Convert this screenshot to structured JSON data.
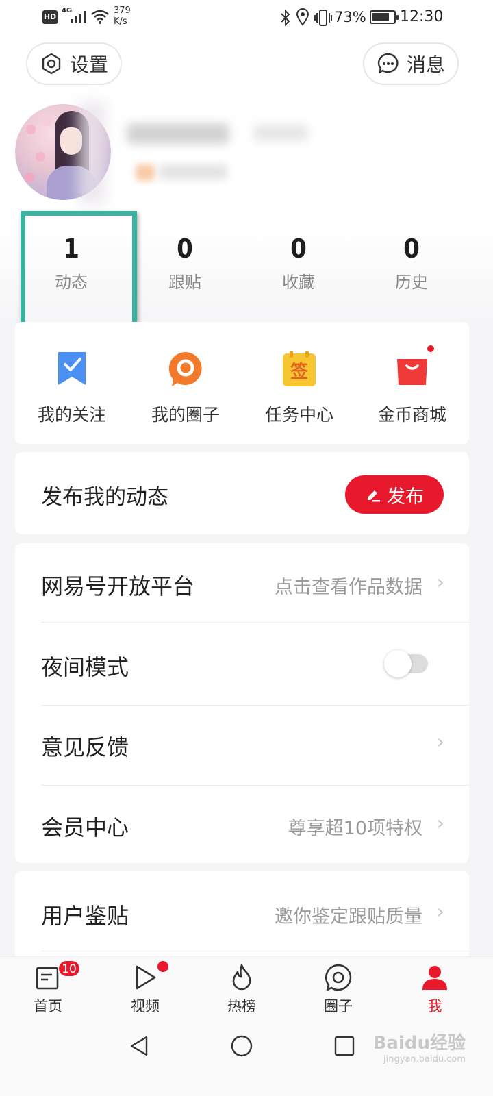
{
  "status_bar": {
    "hd": "HD",
    "network": "4G",
    "speed_value": "379",
    "speed_unit": "K/s",
    "battery": "73%",
    "time": "12:30"
  },
  "header": {
    "settings_label": "设置",
    "messages_label": "消息"
  },
  "stats": [
    {
      "value": "1",
      "label": "动态"
    },
    {
      "value": "0",
      "label": "跟贴"
    },
    {
      "value": "0",
      "label": "收藏"
    },
    {
      "value": "0",
      "label": "历史"
    }
  ],
  "quick_actions": [
    {
      "label": "我的关注",
      "icon": "bookmark-check-icon"
    },
    {
      "label": "我的圈子",
      "icon": "circle-chat-icon"
    },
    {
      "label": "任务中心",
      "icon": "sign-in-calendar-icon",
      "icon_text": "签"
    },
    {
      "label": "金币商城",
      "icon": "shopping-bag-icon"
    }
  ],
  "publish": {
    "title": "发布我的动态",
    "button_label": "发布"
  },
  "menu": [
    {
      "title": "网易号开放平台",
      "subtitle": "点击查看作品数据"
    },
    {
      "title": "夜间模式",
      "toggle": false
    },
    {
      "title": "意见反馈"
    },
    {
      "title": "会员中心",
      "subtitle": "尊享超10项特权"
    }
  ],
  "menu2": [
    {
      "title": "用户鉴贴",
      "subtitle": "邀你鉴定跟贴质量"
    }
  ],
  "bottom_nav": [
    {
      "label": "首页",
      "icon": "news-icon",
      "badge": "10"
    },
    {
      "label": "视频",
      "icon": "play-icon",
      "dot": true
    },
    {
      "label": "热榜",
      "icon": "flame-icon"
    },
    {
      "label": "圈子",
      "icon": "circle-icon"
    },
    {
      "label": "我",
      "icon": "person-icon",
      "active": true
    }
  ],
  "watermark": {
    "text": "Baidu经验",
    "url": "jingyan.baidu.com"
  },
  "colors": {
    "accent": "#e8192c",
    "highlight": "#3bb3a0",
    "secondary_text": "#9a9a9a"
  }
}
